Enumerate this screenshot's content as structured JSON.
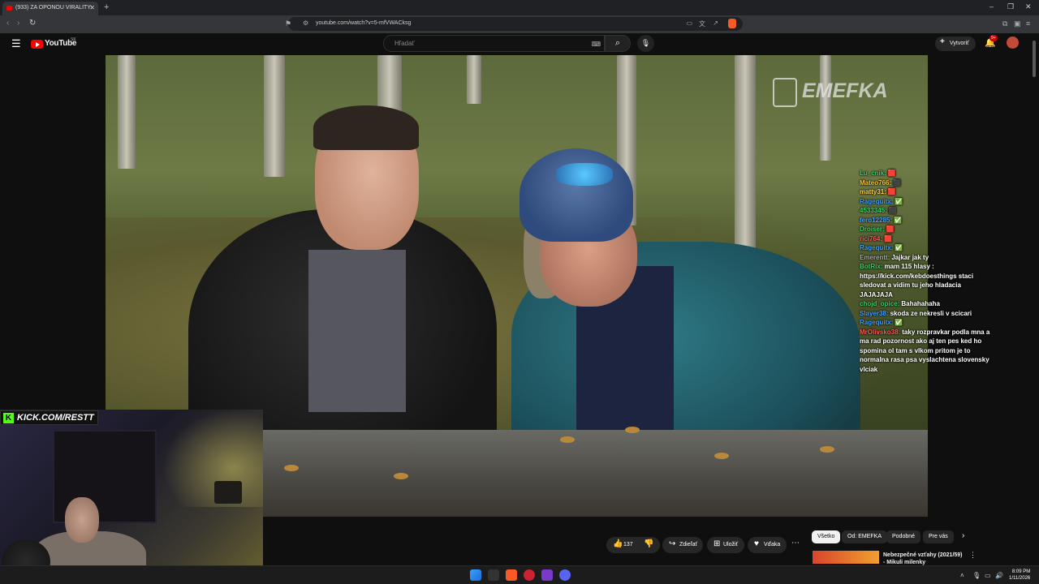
{
  "browser": {
    "tab_title": "(933) ZA OPONOU VIRALITY:",
    "new_tab": "+",
    "url": "youtube.com/watch?v=5-mfVWACksg",
    "window_controls": [
      "–",
      "❐",
      "✕"
    ]
  },
  "youtube": {
    "logo_text": "YouTube",
    "logo_region": "SK",
    "search_placeholder": "Hľadať",
    "create_label": "Vytvoriť",
    "notifications_badge": "9+"
  },
  "video": {
    "watermark": "EMEFKA",
    "overlay_banner": "KICK.COM/RESTT"
  },
  "chat": [
    {
      "user": "Lu_cnik:",
      "color": "#3ad06a",
      "msg": "🟥"
    },
    {
      "user": "Mateo766:",
      "color": "#f7c33a",
      "msg": "⬛"
    },
    {
      "user": "matty31:",
      "color": "#ffd24a",
      "msg": "🟥"
    },
    {
      "user": "Ragequitx:",
      "color": "#3aa0ff",
      "msg": "✅"
    },
    {
      "user": "4533345:",
      "color": "#3ad06a",
      "msg": "⬛"
    },
    {
      "user": "fero12285:",
      "color": "#4aa0ff",
      "msg": "✅"
    },
    {
      "user": "Droiser:",
      "color": "#3ad06a",
      "msg": "🟥"
    },
    {
      "user": "rici764:",
      "color": "#ff5a5a",
      "msg": "🟥"
    },
    {
      "user": "Ragequitx:",
      "color": "#3aa0ff",
      "msg": "✅"
    },
    {
      "user": "Emerentt:",
      "color": "#aaaaaa",
      "msg": "Jajkar jak ty"
    },
    {
      "user": "BotRix:",
      "color": "#3ad06a",
      "msg": "mam 115 hlasy : https://kick.com/kebdoesthings staci sledovat a vidim tu jeho hladacia JAJAJAJA"
    },
    {
      "user": "chojd_opice:",
      "color": "#3ad06a",
      "msg": "Bahahahaha"
    },
    {
      "user": "Slayer38:",
      "color": "#4aa0ff",
      "msg": "skoda ze nekresli v scicari"
    },
    {
      "user": "Ragequitx:",
      "color": "#3aa0ff",
      "msg": "✅"
    },
    {
      "user": "MrOlivsko38:",
      "color": "#ff5a5a",
      "msg": "taky rozpravkar podla mna a ma rad pozornost ako aj ten pes ked ho spomina ol tam s vlkom pritom je to normalna rasa psa vyslachtena slovensky vlciak"
    }
  ],
  "actions": {
    "likes": "137",
    "share": "Zdieľať",
    "save": "Uložiť",
    "thanks": "Vďaka"
  },
  "filters": [
    "Všetko",
    "Od: EMEFKA",
    "Podobné",
    "Pre vás"
  ],
  "recommended": {
    "title": "Nebezpečné vzťahy (2021/59) - Mikuli milenky"
  },
  "taskbar": {
    "time": "8:09 PM",
    "date": "1/11/2026"
  },
  "icons": {
    "menu": "menu-icon",
    "search": "search-icon",
    "mic": "mic-icon",
    "bell": "bell-icon",
    "like": "thumbs-up-icon",
    "dislike": "thumbs-down-icon"
  }
}
